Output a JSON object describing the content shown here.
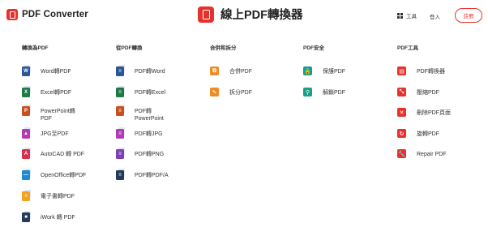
{
  "header": {
    "brand_name": "PDF Converter",
    "center_title": "線上PDF轉換器",
    "tools_label": "工具",
    "login_label": "登入",
    "signup_label": "註冊"
  },
  "columns": [
    {
      "title": "轉換為PDF",
      "items": [
        {
          "label": "Word轉PDF",
          "icon": "word-icon",
          "color": "#2b5797",
          "glyph": "W"
        },
        {
          "label": "Excel轉PDF",
          "icon": "excel-icon",
          "color": "#1e7b45",
          "glyph": "X"
        },
        {
          "label": "PowerPoint轉\nPDF",
          "icon": "powerpoint-icon",
          "color": "#c8501e",
          "glyph": "P"
        },
        {
          "label": "JPG至PDF",
          "icon": "jpg-icon",
          "color": "#b13bb3",
          "glyph": "▲"
        },
        {
          "label": "AutoCAD 轉 PDF",
          "icon": "autocad-icon",
          "color": "#d6304a",
          "glyph": "A"
        },
        {
          "label": "OpenOffice轉PDF",
          "icon": "openoffice-icon",
          "color": "#1d8ad1",
          "glyph": "—"
        },
        {
          "label": "電子書轉PDF",
          "icon": "ebook-icon",
          "color": "#f3a21a",
          "glyph": "≡"
        },
        {
          "label": "iWork 轉 PDF",
          "icon": "iwork-icon",
          "color": "#253a5b",
          "glyph": "■"
        }
      ]
    },
    {
      "title": "從PDF轉換",
      "items": [
        {
          "label": "PDF轉Word",
          "icon": "pdf-to-word-icon",
          "color": "#2b5797",
          "glyph": "≡"
        },
        {
          "label": "PDF轉Excel",
          "icon": "pdf-to-excel-icon",
          "color": "#1e7b45",
          "glyph": "≡"
        },
        {
          "label": "PDF轉\nPowerPoint",
          "icon": "pdf-to-powerpoint-icon",
          "color": "#c8501e",
          "glyph": "≡"
        },
        {
          "label": "PDF轉JPG",
          "icon": "pdf-to-jpg-icon",
          "color": "#b13bb3",
          "glyph": "≡"
        },
        {
          "label": "PDF轉PNG",
          "icon": "pdf-to-png-icon",
          "color": "#7f3fb5",
          "glyph": "≡"
        },
        {
          "label": "PDF轉PDF/A",
          "icon": "pdf-to-pdfa-icon",
          "color": "#253a5b",
          "glyph": "≡"
        }
      ]
    },
    {
      "title": "合併和拆分",
      "items": [
        {
          "label": "合併PDF",
          "icon": "merge-icon",
          "color": "#f08a24",
          "glyph": "⧉"
        },
        {
          "label": "拆分PDF",
          "icon": "split-icon",
          "color": "#f08a24",
          "glyph": "✎"
        }
      ]
    },
    {
      "title": "PDF安全",
      "items": [
        {
          "label": "保護PDF",
          "icon": "lock-icon",
          "color": "#16a085",
          "glyph": "🔒"
        },
        {
          "label": "解鎖PDF",
          "icon": "key-icon",
          "color": "#16a085",
          "glyph": "⚲"
        }
      ]
    },
    {
      "title": "PDF工具",
      "items": [
        {
          "label": "PDF轉換器",
          "icon": "converter-icon",
          "color": "#e5322d",
          "glyph": "▤"
        },
        {
          "label": "壓縮PDF",
          "icon": "compress-icon",
          "color": "#e5322d",
          "glyph": "⤡"
        },
        {
          "label": "刪除PDF頁面",
          "icon": "delete-pages-icon",
          "color": "#e5322d",
          "glyph": "✕"
        },
        {
          "label": "旋轉PDF",
          "icon": "rotate-icon",
          "color": "#e5322d",
          "glyph": "↻"
        },
        {
          "label": "Repair PDF",
          "icon": "repair-icon",
          "color": "#e5322d",
          "glyph": "🔧"
        }
      ]
    }
  ]
}
